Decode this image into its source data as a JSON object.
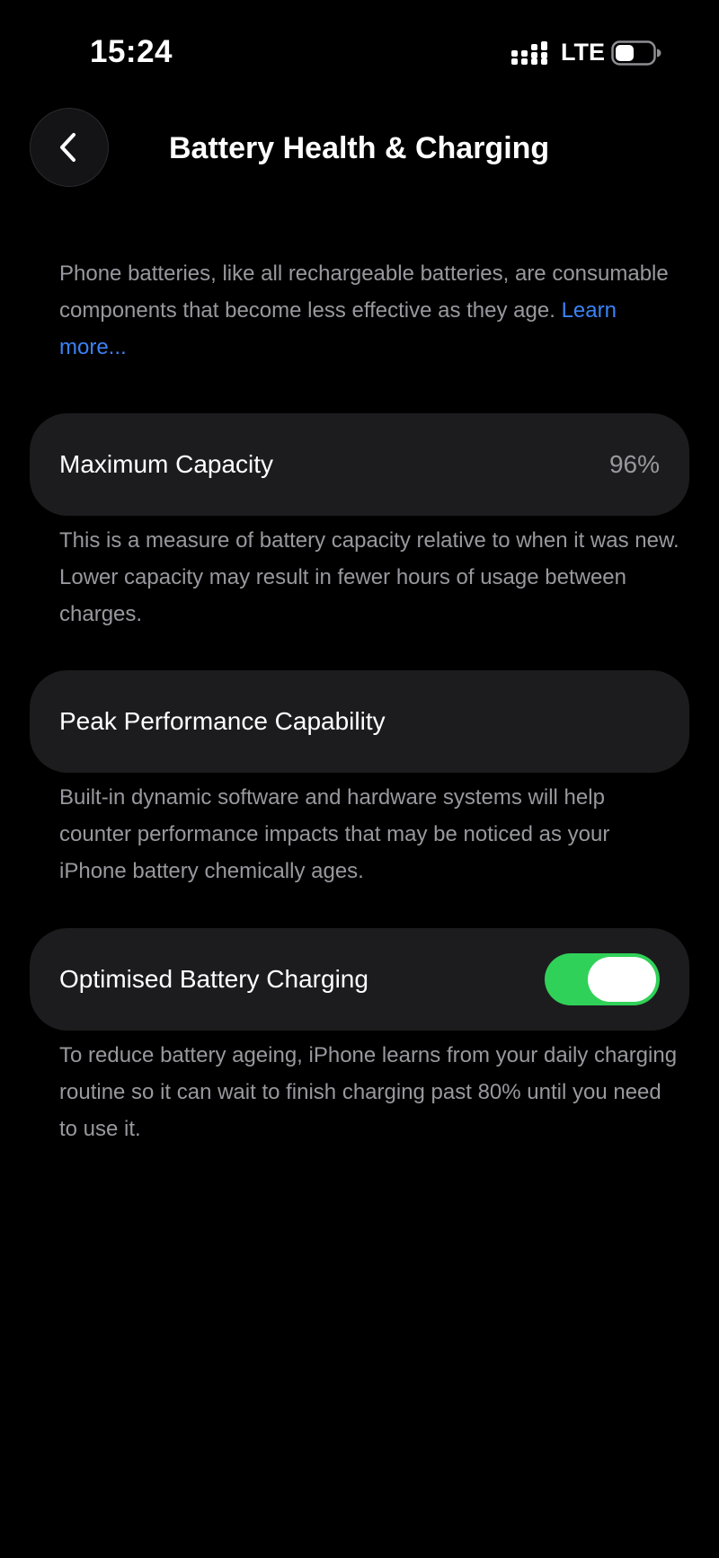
{
  "status_bar": {
    "time": "15:24",
    "network": "LTE",
    "icons": {
      "signal": "cellular-signal-icon",
      "battery": "battery-icon"
    }
  },
  "header": {
    "back_icon": "chevron-left-icon",
    "title": "Battery Health & Charging"
  },
  "intro": {
    "text": "Phone batteries, like all rechargeable batteries, are consumable components that become less effective as they age. ",
    "link": "Learn more..."
  },
  "sections": {
    "maximum_capacity": {
      "label": "Maximum Capacity",
      "value": "96%",
      "description": "This is a measure of battery capacity relative to when it was new. Lower capacity may result in fewer hours of usage between charges."
    },
    "peak_performance": {
      "label": "Peak Performance Capability",
      "description": "Built-in dynamic software and hardware systems will help counter performance impacts that may be noticed as your iPhone battery chemically ages."
    },
    "optimised_charging": {
      "label": "Optimised Battery Charging",
      "enabled": true,
      "description": "To reduce battery ageing, iPhone learns from your daily charging routine so it can wait to finish charging past 80% until you need to use it."
    }
  },
  "colors": {
    "background": "#000000",
    "card": "#1c1c1e",
    "secondary_text": "#98989e",
    "link": "#3b82f6",
    "toggle_on": "#30d158"
  }
}
